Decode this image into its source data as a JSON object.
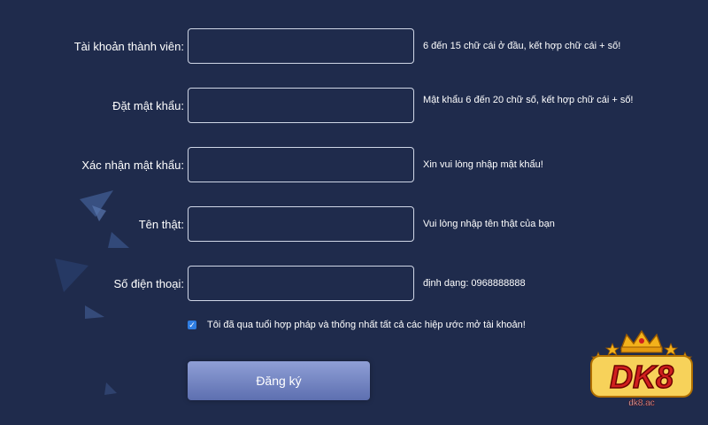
{
  "colors": {
    "background": "#1f2b4c",
    "input_border": "#cfd6e6",
    "button_top": "#8f9fd6",
    "button_bottom": "#5d6fb0",
    "checkbox": "#2f7de1",
    "logo_red": "#d01f1f",
    "logo_gold": "#f3b21b"
  },
  "form": {
    "fields": [
      {
        "label": "Tài khoản thành viên:",
        "value": "",
        "hint": "6 đến 15 chữ cái ở đầu, kết hợp chữ cái + số!"
      },
      {
        "label": "Đặt mật khẩu:",
        "value": "",
        "hint": "Mật khẩu 6 đến 20 chữ số, kết hợp chữ cái + số!"
      },
      {
        "label": "Xác nhận mật khẩu:",
        "value": "",
        "hint": "Xin vui lòng nhập mật khẩu!"
      },
      {
        "label": "Tên thật:",
        "value": "",
        "hint": "Vui lòng nhập tên thật của bạn"
      },
      {
        "label": "Số điện thoại:",
        "value": "",
        "hint": "định dạng: 0968888888"
      }
    ],
    "agreement": {
      "checked": true,
      "check_glyph": "✓",
      "text": "Tôi đã qua tuổi hợp pháp và thống nhất tất cả các hiệp ước mở tài khoản!"
    },
    "submit_label": "Đăng ký"
  },
  "logo": {
    "brand": "DK8",
    "domain": "dk8.ac",
    "icon": "crown-icon"
  }
}
